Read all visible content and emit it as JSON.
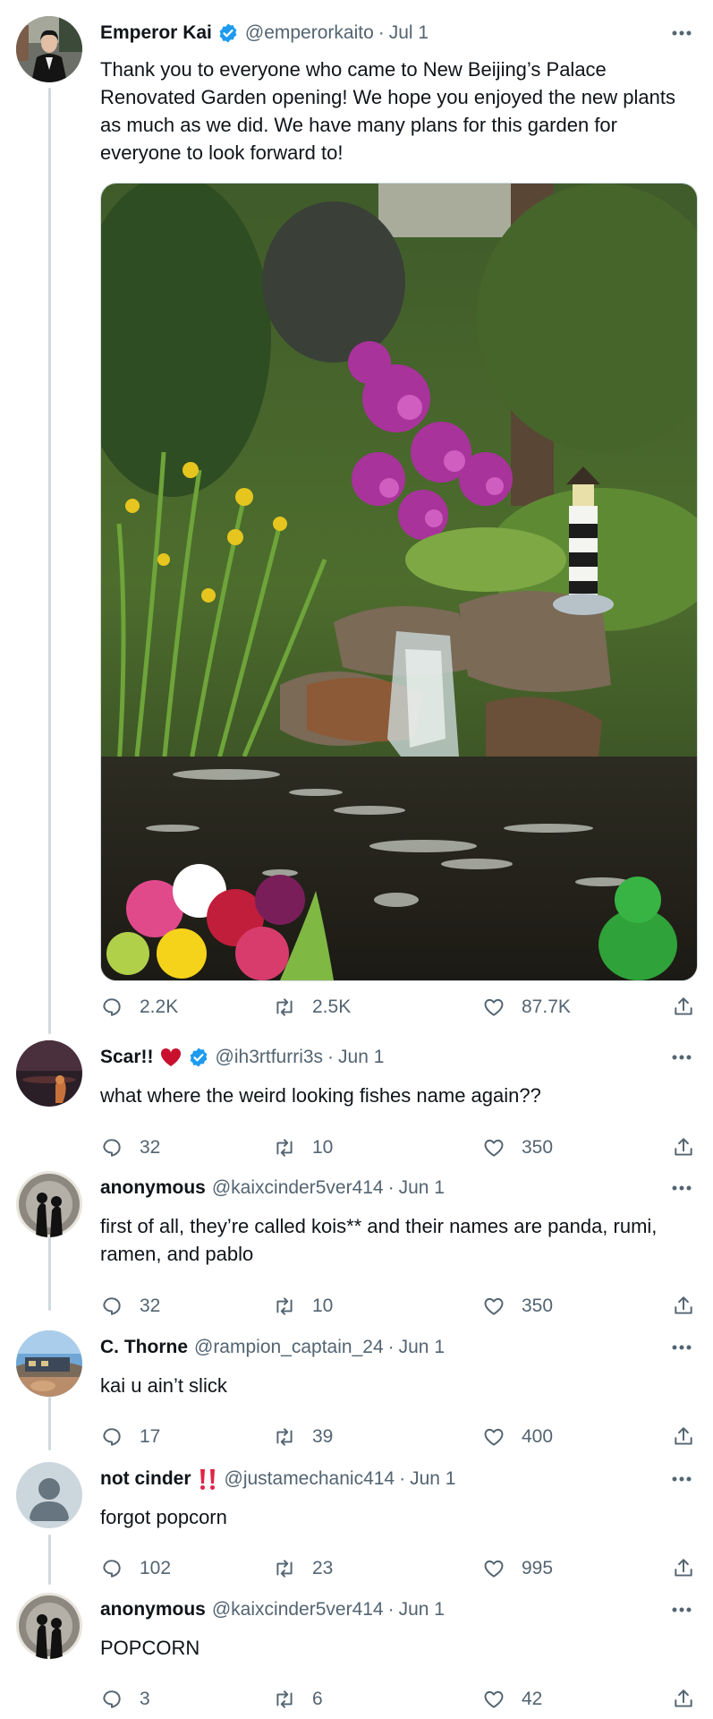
{
  "main_tweet": {
    "name": "Emperor Kai",
    "handle": "@emperorkaito",
    "date": "Jul 1",
    "text": "Thank you to everyone who came to New Beijing’s Palace Renovated Garden opening! We hope you enjoyed the new plants as much as we did. We have many plans for this garden for everyone to look forward to!",
    "media_icon": "garden-waterfall-photo",
    "stats": {
      "replies": "2.2K",
      "retweets": "2.5K",
      "likes": "87.7K"
    }
  },
  "replies": [
    {
      "name": "Scar!!",
      "name_emoji": "heart",
      "verified": true,
      "handle": "@ih3rtfurri3s",
      "date": "Jun 1",
      "text": "what where the weird looking fishes name again??",
      "stats": {
        "replies": "32",
        "retweets": "10",
        "likes": "350"
      }
    },
    {
      "name": "anonymous",
      "handle": "@kaixcinder5ver414",
      "date": "Jun 1",
      "text": "first of all, they’re called kois** and their names are panda, rumi, ramen, and pablo",
      "stats": {
        "replies": "32",
        "retweets": "10",
        "likes": "350"
      }
    },
    {
      "name": "C. Thorne",
      "handle": "@rampion_captain_24",
      "date": "Jun 1",
      "text": "kai u ain’t slick",
      "stats": {
        "replies": "17",
        "retweets": "39",
        "likes": "400"
      }
    },
    {
      "name": "not cinder",
      "name_emoji": "double-exclamation",
      "handle": "@justamechanic414",
      "date": "Jun 1",
      "text": "forgot popcorn",
      "stats": {
        "replies": "102",
        "retweets": "23",
        "likes": "995"
      }
    },
    {
      "name": "anonymous",
      "handle": "@kaixcinder5ver414",
      "date": "Jun 1",
      "text": "POPCORN",
      "stats": {
        "replies": "3",
        "retweets": "6",
        "likes": "42"
      }
    }
  ],
  "colors": {
    "verified": "#1d9bf0",
    "heart_emoji": "#c8102e",
    "exclamation_emoji": "#e0244a",
    "secondary_text": "#536471",
    "thread_line": "#cfd9de"
  },
  "separator": "·"
}
